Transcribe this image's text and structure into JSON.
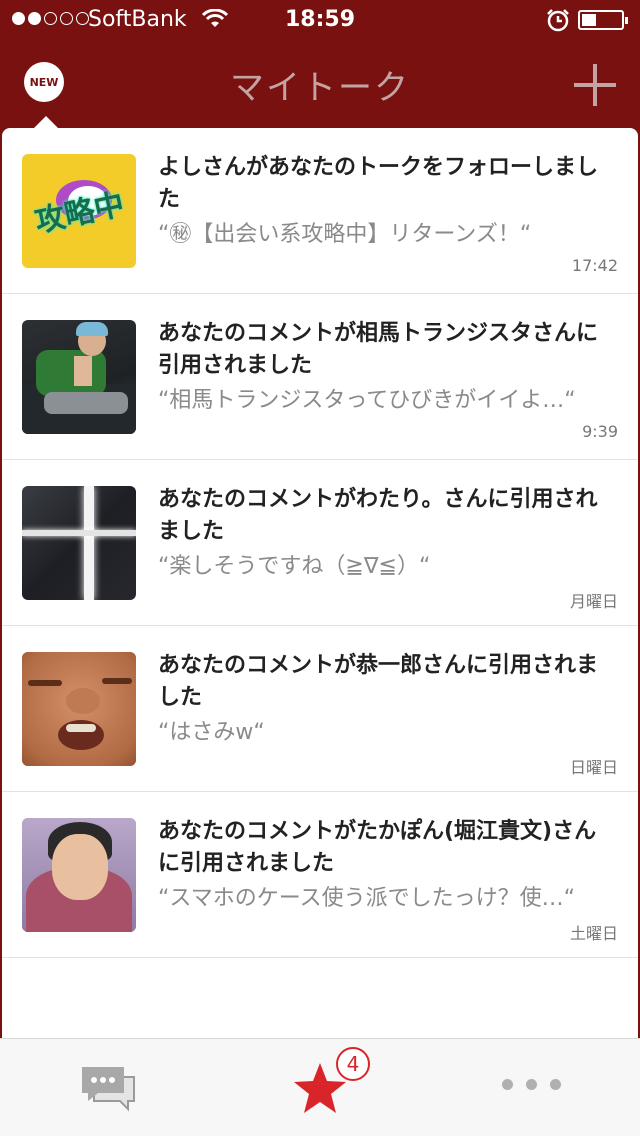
{
  "status_bar": {
    "carrier": "SoftBank",
    "time": "18:59",
    "signal_bars_filled": 2,
    "signal_bars_total": 5,
    "battery_level": 0.3
  },
  "nav": {
    "new_badge": "NEW",
    "title": "マイトーク",
    "add_icon": "plus-icon"
  },
  "notifications": [
    {
      "title": "よしさんがあなたのトークをフォローしました",
      "quote": "“㊙【出会い系攻略中】リターンズ！“",
      "time": "17:42",
      "thumb_text": "攻略中"
    },
    {
      "title": "あなたのコメントが相馬トランジスタさんに引用されました",
      "quote": "“相馬トランジスタってひびきがイイよ…“",
      "time": "9:39"
    },
    {
      "title": "あなたのコメントがわたり。さんに引用されました",
      "quote": "“楽しそうですね（≧∇≦）“",
      "time": "月曜日"
    },
    {
      "title": "あなたのコメントが恭一郎さんに引用されました",
      "quote": "“はさみw“",
      "time": "日曜日"
    },
    {
      "title": "あなたのコメントがたかぽん(堀江貴文)さんに引用されました",
      "quote": "“スマホのケース使う派でしたっけ？使…“",
      "time": "土曜日"
    }
  ],
  "tab_bar": {
    "badge_count": "4",
    "icons": [
      "chat-bubbles-icon",
      "star-icon",
      "more-dots-icon"
    ],
    "accent_color": "#d9252a"
  },
  "colors": {
    "header": "#7a1111",
    "title_text": "#c4a3a3"
  }
}
